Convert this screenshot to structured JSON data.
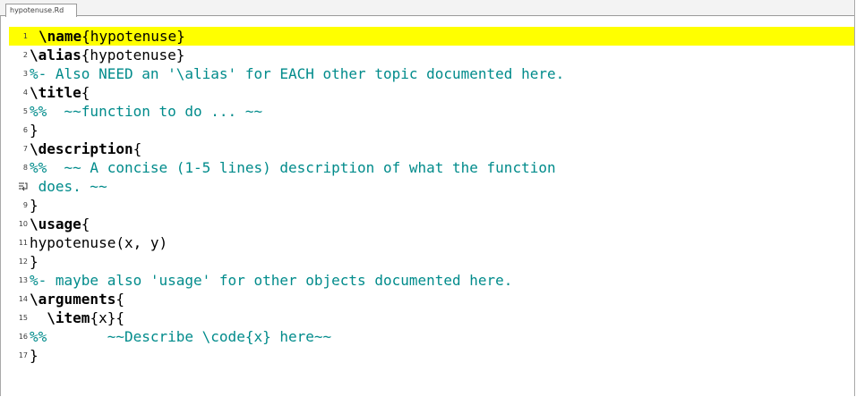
{
  "tab": {
    "filename": "hypotenuse.Rd"
  },
  "editor": {
    "lines": [
      {
        "num": "1",
        "cmd": "\\name",
        "rest": "{hypotenuse}"
      },
      {
        "num": "2",
        "cmd": "\\alias",
        "rest": "{hypotenuse}"
      },
      {
        "num": "3",
        "comment": "%- Also NEED an '\\alias' for EACH other topic documented here."
      },
      {
        "num": "4",
        "cmd": "\\title",
        "rest": "{"
      },
      {
        "num": "5",
        "comment": "%%  ~~function to do ... ~~"
      },
      {
        "num": "6",
        "rest": "}"
      },
      {
        "num": "7",
        "cmd": "\\description",
        "rest": "{"
      },
      {
        "num": "8",
        "comment": "%%  ~~ A concise (1-5 lines) description of what the function"
      },
      {
        "num": "",
        "comment": " does. ~~"
      },
      {
        "num": "9",
        "rest": "}"
      },
      {
        "num": "10",
        "cmd": "\\usage",
        "rest": "{"
      },
      {
        "num": "11",
        "rest": "hypotenuse(x, y)"
      },
      {
        "num": "12",
        "rest": "}"
      },
      {
        "num": "13",
        "comment": "%- maybe also 'usage' for other objects documented here."
      },
      {
        "num": "14",
        "cmd": "\\arguments",
        "rest": "{"
      },
      {
        "num": "15",
        "pre": "  ",
        "cmd": "\\item",
        "rest": "{x}{"
      },
      {
        "num": "16",
        "comment": "%%       ~~Describe \\code{x} here~~"
      },
      {
        "num": "17",
        "rest": "}"
      }
    ]
  }
}
